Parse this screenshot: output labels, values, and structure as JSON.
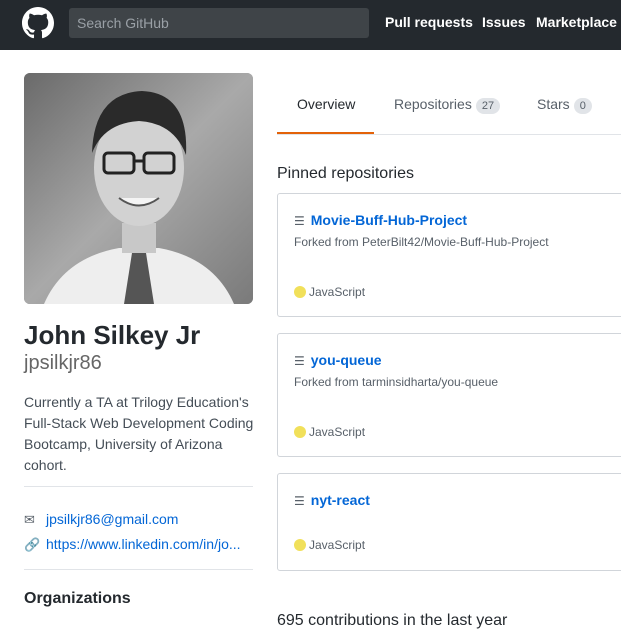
{
  "header": {
    "search_placeholder": "Search GitHub",
    "nav": [
      "Pull requests",
      "Issues",
      "Marketplace"
    ]
  },
  "profile": {
    "full_name": "John Silkey Jr",
    "username": "jpsilkjr86",
    "bio": "Currently a TA at Trilogy Education's Full-Stack Web Development Coding Bootcamp, University of Arizona cohort.",
    "email": "jpsilkjr86@gmail.com",
    "website": "https://www.linkedin.com/in/jo...",
    "organizations_heading": "Organizations"
  },
  "tabs": [
    {
      "label": "Overview",
      "count": ""
    },
    {
      "label": "Repositories",
      "count": "27"
    },
    {
      "label": "Stars",
      "count": "0"
    }
  ],
  "pinned": {
    "heading": "Pinned repositories",
    "repos": [
      {
        "name": "Movie-Buff-Hub-Project",
        "forked_from": "Forked from PeterBilt42/Movie-Buff-Hub-Project",
        "language": "JavaScript"
      },
      {
        "name": "you-queue",
        "forked_from": "Forked from tarminsidharta/you-queue",
        "language": "JavaScript"
      },
      {
        "name": "nyt-react",
        "forked_from": "",
        "language": "JavaScript"
      }
    ]
  },
  "contributions_heading": "695 contributions in the last year",
  "colors": {
    "header_bg": "#24292e",
    "link": "#0366d6",
    "active_tab": "#e36209",
    "javascript": "#f1e05a"
  },
  "icons": [
    "github-logo-icon",
    "mail-icon",
    "link-icon",
    "repo-icon"
  ]
}
